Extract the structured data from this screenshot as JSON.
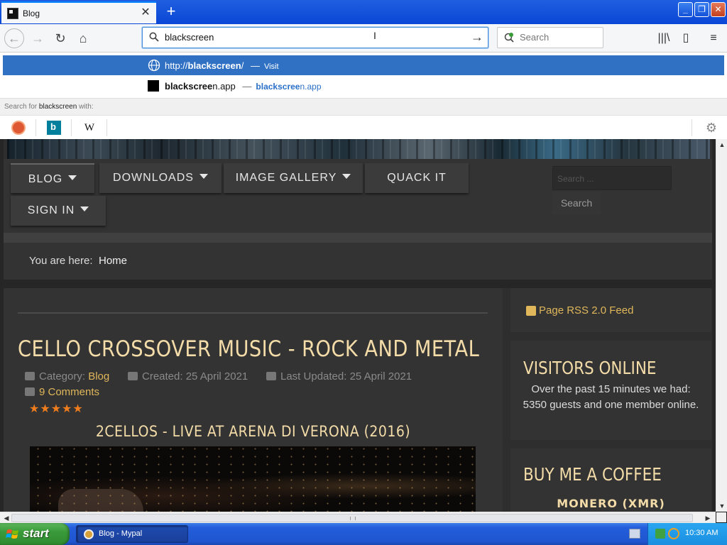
{
  "browser": {
    "tab_title": "Blog",
    "new_tab_symbol": "+",
    "url_text": "blackscreen",
    "search_placeholder": "Search"
  },
  "dropdown": {
    "suggestion1_url_prefix": "http://",
    "suggestion1_url_bold": "blackscreen",
    "suggestion1_url_suffix": "/",
    "suggestion1_sep": "—",
    "suggestion1_action": "Visit",
    "suggestion2_title_bold": "blackscree",
    "suggestion2_title_rest": "n.app",
    "suggestion2_sep": "—",
    "suggestion2_url_bold": "blackscree",
    "suggestion2_url_rest": "n.app",
    "search_with_prefix": "Search for",
    "search_with_term": "blackscreen",
    "search_with_suffix": "with:",
    "engines": [
      "duckduckgo-icon",
      "bing-icon",
      "wikipedia-icon"
    ],
    "wiki_glyph": "W",
    "bing_glyph": "b"
  },
  "site": {
    "menu": {
      "blog": "BLOG",
      "downloads": "DOWNLOADS",
      "gallery": "IMAGE GALLERY",
      "quack": "QUACK IT",
      "signin": "SIGN IN"
    },
    "search_placeholder": "Search ...",
    "search_button": "Search",
    "breadcrumb_label": "You are here:",
    "breadcrumb_home": "Home",
    "article": {
      "title": "CELLO CROSSOVER MUSIC - ROCK AND METAL",
      "category_label": "Category:",
      "category_value": "Blog",
      "created": "Created: 25 April 2021",
      "updated": "Last Updated: 25 April 2021",
      "comments": "9 Comments",
      "stars": "★★★★★",
      "subtitle": "2CELLOS - LIVE AT ARENA DI VERONA (2016)"
    },
    "sidebar": {
      "rss": "Page RSS 2.0 Feed",
      "visitors_title": "VISITORS ONLINE",
      "visitors_text": "Over the past 15 minutes we had: 5350 guests and one member online.",
      "coffee_title": "BUY ME A COFFEE",
      "coffee_sub": "MONERO (XMR)"
    }
  },
  "taskbar": {
    "start": "start",
    "window": "Blog - Mypal",
    "clock": "10:30 AM"
  },
  "colors": {
    "accent": "#3071c4",
    "heading": "#f3dca8",
    "link": "#e0b75a",
    "stars": "#f07d1d"
  }
}
